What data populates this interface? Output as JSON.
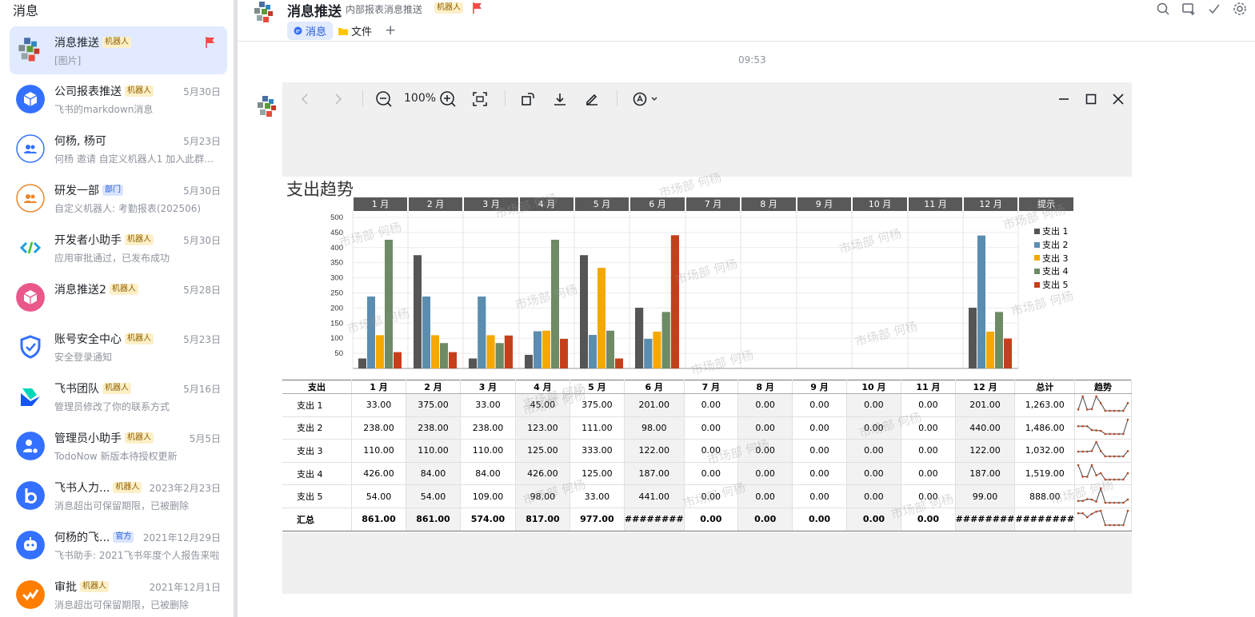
{
  "sidebar": {
    "title": "消息",
    "chats": [
      {
        "name": "消息推送",
        "badge": "机器人",
        "badge_type": "bot",
        "time": "",
        "preview": "[图片]",
        "flag": true,
        "avatar": "mosaic-avatar-icon",
        "color": "#e34d3b"
      },
      {
        "name": "公司报表推送",
        "badge": "机器人",
        "badge_type": "bot",
        "time": "5月30日",
        "preview": "飞书的markdown消息",
        "avatar": "cube-icon",
        "color": "#3370ff"
      },
      {
        "name": "何杨, 杨可",
        "badge": "",
        "badge_type": "",
        "time": "5月23日",
        "preview": "何杨 邀请 自定义机器人1 加入此群，...",
        "avatar": "group-icon",
        "color": "#3370ff"
      },
      {
        "name": "研发一部",
        "badge": "部门",
        "badge_type": "dept",
        "time": "5月30日",
        "preview": "自定义机器人: 考勤报表(202506)",
        "avatar": "group-icon",
        "color": "#e8852b"
      },
      {
        "name": "开发者小助手",
        "badge": "机器人",
        "badge_type": "bot",
        "time": "5月30日",
        "preview": "应用审批通过，已发布成功",
        "avatar": "code-icon",
        "color": "#1ca0e3"
      },
      {
        "name": "消息推送2",
        "badge": "机器人",
        "badge_type": "bot",
        "time": "5月28日",
        "preview": "",
        "avatar": "cube-icon",
        "color": "#e9578b"
      },
      {
        "name": "账号安全中心",
        "badge": "机器人",
        "badge_type": "bot",
        "time": "5月23日",
        "preview": "安全登录通知",
        "avatar": "shield-icon",
        "color": "#3370ff"
      },
      {
        "name": "飞书团队",
        "badge": "机器人",
        "badge_type": "bot",
        "time": "5月16日",
        "preview": "管理员修改了你的联系方式",
        "avatar": "feishu-logo-icon",
        "color": "#1456f0"
      },
      {
        "name": "管理员小助手",
        "badge": "机器人",
        "badge_type": "bot",
        "time": "5月5日",
        "preview": "TodoNow 新版本待授权更新",
        "avatar": "user-gear-icon",
        "color": "#3370ff"
      },
      {
        "name": "飞书人力...",
        "badge": "机器人",
        "badge_type": "bot",
        "time": "2023年2月23日",
        "preview": "消息超出可保留期限，已被删除",
        "avatar": "letter-b-icon",
        "color": "#3370ff"
      },
      {
        "name": "何杨的飞...",
        "badge": "官方",
        "badge_type": "dept",
        "time": "2021年12月29日",
        "preview": "飞书助手: 2021飞书年度个人报告来啦",
        "avatar": "robot-icon",
        "color": "#3370ff"
      },
      {
        "name": "审批",
        "badge": "机器人",
        "badge_type": "bot",
        "time": "2021年12月1日",
        "preview": "消息超出可保留期限，已被删除",
        "avatar": "check-icon",
        "color": "#ff7d00"
      }
    ]
  },
  "header": {
    "title": "消息推送",
    "desc": "内部报表消息推送",
    "badge": "机器人",
    "tabs": [
      {
        "label": "消息",
        "icon": "chat-bubble-icon"
      },
      {
        "label": "文件",
        "icon": "folder-icon"
      }
    ],
    "add": "+"
  },
  "message": {
    "time": "09:53"
  },
  "viewer": {
    "zoom": "100%"
  },
  "sheet": {
    "title": "支出趋势",
    "months": [
      "1 月",
      "2 月",
      "3 月",
      "4 月",
      "5 月",
      "6 月",
      "7 月",
      "8 月",
      "9 月",
      "10 月",
      "11 月",
      "12 月"
    ],
    "hint": "提示",
    "watermark": "市场部 何杨",
    "table_headers": [
      "支出",
      "1 月",
      "2 月",
      "3 月",
      "4 月",
      "5 月",
      "6 月",
      "7 月",
      "8 月",
      "9 月",
      "10 月",
      "11 月",
      "12 月",
      "总计",
      "趋势"
    ],
    "rows": [
      {
        "label": "支出 1",
        "cells": [
          "33.00",
          "375.00",
          "33.00",
          "45.00",
          "375.00",
          "201.00",
          "0.00",
          "0.00",
          "0.00",
          "0.00",
          "0.00",
          "201.00",
          "1,263.00"
        ]
      },
      {
        "label": "支出 2",
        "cells": [
          "238.00",
          "238.00",
          "238.00",
          "123.00",
          "111.00",
          "98.00",
          "0.00",
          "0.00",
          "0.00",
          "0.00",
          "0.00",
          "440.00",
          "1,486.00"
        ]
      },
      {
        "label": "支出 3",
        "cells": [
          "110.00",
          "110.00",
          "110.00",
          "125.00",
          "333.00",
          "122.00",
          "0.00",
          "0.00",
          "0.00",
          "0.00",
          "0.00",
          "122.00",
          "1,032.00"
        ]
      },
      {
        "label": "支出 4",
        "cells": [
          "426.00",
          "84.00",
          "84.00",
          "426.00",
          "125.00",
          "187.00",
          "0.00",
          "0.00",
          "0.00",
          "0.00",
          "0.00",
          "187.00",
          "1,519.00"
        ]
      },
      {
        "label": "支出 5",
        "cells": [
          "54.00",
          "54.00",
          "109.00",
          "98.00",
          "33.00",
          "441.00",
          "0.00",
          "0.00",
          "0.00",
          "0.00",
          "0.00",
          "99.00",
          "888.00"
        ]
      }
    ],
    "total": {
      "label": "汇总",
      "cells": [
        "861.00",
        "861.00",
        "574.00",
        "817.00",
        "977.00",
        "########",
        "0.00",
        "0.00",
        "0.00",
        "0.00",
        "0.00",
        "########",
        "########"
      ]
    }
  },
  "chart_data": {
    "type": "bar",
    "categories": [
      "1 月",
      "2 月",
      "3 月",
      "4 月",
      "5 月",
      "6 月",
      "7 月",
      "8 月",
      "9 月",
      "10 月",
      "11 月",
      "12 月"
    ],
    "series": [
      {
        "name": "支出 1",
        "color": "#555555",
        "values": [
          33,
          375,
          33,
          45,
          375,
          201,
          0,
          0,
          0,
          0,
          0,
          201
        ]
      },
      {
        "name": "支出 2",
        "color": "#5b8db0",
        "values": [
          238,
          238,
          238,
          123,
          111,
          98,
          0,
          0,
          0,
          0,
          0,
          440
        ]
      },
      {
        "name": "支出 3",
        "color": "#f5a800",
        "values": [
          110,
          110,
          110,
          125,
          333,
          122,
          0,
          0,
          0,
          0,
          0,
          122
        ]
      },
      {
        "name": "支出 4",
        "color": "#6e8b65",
        "values": [
          426,
          84,
          84,
          426,
          125,
          187,
          0,
          0,
          0,
          0,
          0,
          187
        ]
      },
      {
        "name": "支出 5",
        "color": "#c5401a",
        "values": [
          54,
          54,
          109,
          98,
          33,
          441,
          0,
          0,
          0,
          0,
          0,
          99
        ]
      }
    ],
    "ylim": [
      0,
      500
    ],
    "yticks": [
      50,
      100,
      150,
      200,
      250,
      300,
      350,
      400,
      450,
      500
    ],
    "legend": "right"
  }
}
